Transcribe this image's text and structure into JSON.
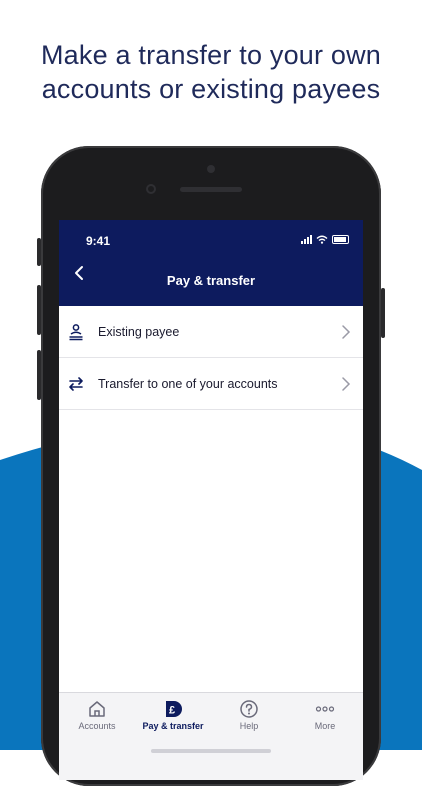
{
  "headline": {
    "line1": "Make a transfer to your own",
    "line2": "accounts or existing payees"
  },
  "colors": {
    "navy": "#0d1b5e",
    "headline": "#1f2a5a",
    "accent_blue": "#0a75bd"
  },
  "status_bar": {
    "time": "9:41"
  },
  "nav": {
    "title": "Pay & transfer",
    "back_icon": "chevron-left-icon"
  },
  "list": [
    {
      "label": "Existing payee",
      "icon": "payee-person-icon"
    },
    {
      "label": "Transfer to one of your accounts",
      "icon": "transfer-arrows-icon"
    }
  ],
  "tabs": [
    {
      "label": "Accounts",
      "icon": "home-icon",
      "active": false
    },
    {
      "label": "Pay & transfer",
      "icon": "pound-icon",
      "active": true
    },
    {
      "label": "Help",
      "icon": "help-icon",
      "active": false
    },
    {
      "label": "More",
      "icon": "more-dots-icon",
      "active": false
    }
  ]
}
